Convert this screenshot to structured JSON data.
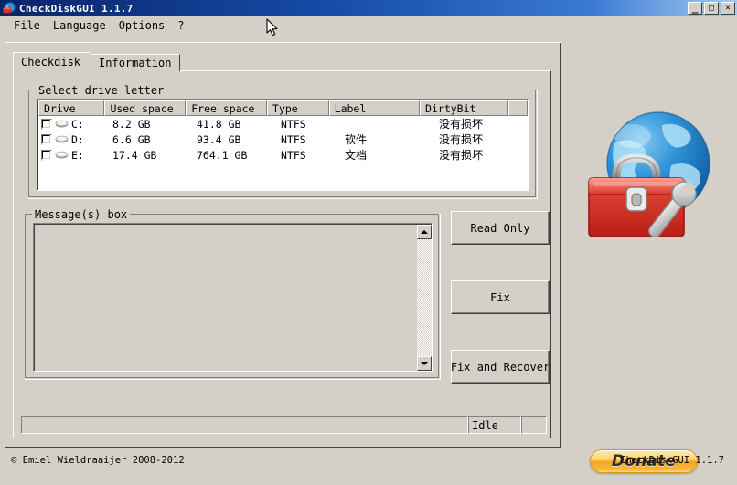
{
  "window": {
    "title": "CheckDiskGUI 1.1.7",
    "icon": "globe-toolbox-icon",
    "controls": {
      "minimize": "_",
      "maximize": "□",
      "close": "✕"
    }
  },
  "menu": {
    "items": [
      {
        "label": "File"
      },
      {
        "label": "Language"
      },
      {
        "label": "Options"
      },
      {
        "label": "?"
      }
    ]
  },
  "tabs": [
    {
      "label": "Checkdisk",
      "active": true
    },
    {
      "label": "Information",
      "active": false
    }
  ],
  "drive_group": {
    "title": "Select drive letter",
    "columns": [
      "Drive",
      "Used space",
      "Free space",
      "Type",
      "Label",
      "DirtyBit"
    ],
    "rows": [
      {
        "checked": false,
        "drive": "C:",
        "used_space": "8.2 GB",
        "free_space": "41.8 GB",
        "type": "NTFS",
        "label": "",
        "dirtybit": "没有损坏"
      },
      {
        "checked": false,
        "drive": "D:",
        "used_space": "6.6 GB",
        "free_space": "93.4 GB",
        "type": "NTFS",
        "label": "软件",
        "dirtybit": "没有损坏"
      },
      {
        "checked": false,
        "drive": "E:",
        "used_space": "17.4 GB",
        "free_space": "764.1 GB",
        "type": "NTFS",
        "label": "文档",
        "dirtybit": "没有损坏"
      }
    ]
  },
  "message_group": {
    "title": "Message(s) box",
    "content": ""
  },
  "actions": {
    "read_only": "Read Only",
    "fix": "Fix",
    "fix_and_recover": "Fix and Recover"
  },
  "statusbar": {
    "main": "",
    "state": "Idle",
    "end": ""
  },
  "donate": {
    "label": "Donate"
  },
  "footer": {
    "copyright": "© Emiel Wieldraaijer 2008-2012",
    "version": "CheckDiskGUI 1.1.7"
  },
  "colors": {
    "window_bg": "#d4d0c8",
    "titlebar_start": "#0a246a",
    "titlebar_end": "#a6caf0",
    "list_bg": "#ffffff",
    "donate_accent": "#f5a623",
    "globe_blue": "#1d7fd0",
    "toolbox_red": "#d8352a"
  }
}
